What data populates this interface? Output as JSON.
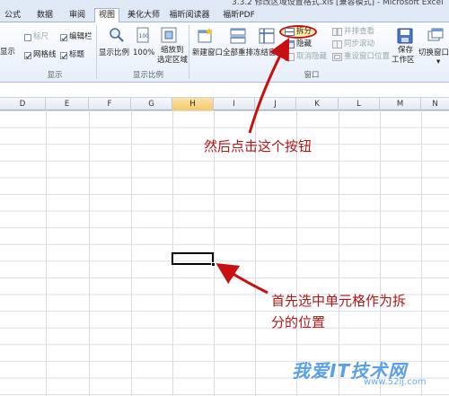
{
  "window": {
    "title": "3.3.2 修改区域设置格式.xls [兼容模式] - Microsoft Excel"
  },
  "tabs": [
    {
      "label": "公式"
    },
    {
      "label": "数据"
    },
    {
      "label": "审阅"
    },
    {
      "label": "视图",
      "active": true
    },
    {
      "label": "美化大师"
    },
    {
      "label": "福昕阅读器"
    },
    {
      "label": "福昕PDF"
    }
  ],
  "ribbon": {
    "show_group": {
      "show_label": "显示",
      "ruler": "标尺",
      "formula_bar": "编辑栏",
      "gridlines": "网格线",
      "headings": "标题",
      "label": "显示"
    },
    "zoom_group": {
      "zoom": "显示比例",
      "zoom_100": "100%",
      "zoom_selection_line1": "缩放到",
      "zoom_selection_line2": "选定区域",
      "label": "显示比例"
    },
    "window_group": {
      "new_window": "新建窗口",
      "arrange_all": "全部重排",
      "freeze_panes": "冻结窗格",
      "split": "拆分",
      "hide": "隐藏",
      "unhide": "取消隐藏",
      "view_side_by_side": "并排查看",
      "sync_scrolling": "同步滚动",
      "reset_position": "重设窗口位置",
      "save_workspace_line1": "保存",
      "save_workspace_line2": "工作区",
      "switch_windows": "切换窗口",
      "label": "窗口"
    }
  },
  "grid": {
    "columns": [
      "D",
      "E",
      "F",
      "G",
      "H",
      "I",
      "J",
      "K",
      "L",
      "M",
      "N"
    ],
    "selected_column": "H"
  },
  "annotations": {
    "button_hint": "然后点击这个按钮",
    "cell_hint_line1": "首先选中单元格作为拆",
    "cell_hint_line2": "分的位置"
  },
  "watermark": {
    "brand": "我爱IT技术网",
    "url": "www.52ij.com"
  },
  "colors": {
    "annotation": "#b11717",
    "selected_header": "#f5c96a",
    "ribbon_bg": "#e6eefa"
  }
}
